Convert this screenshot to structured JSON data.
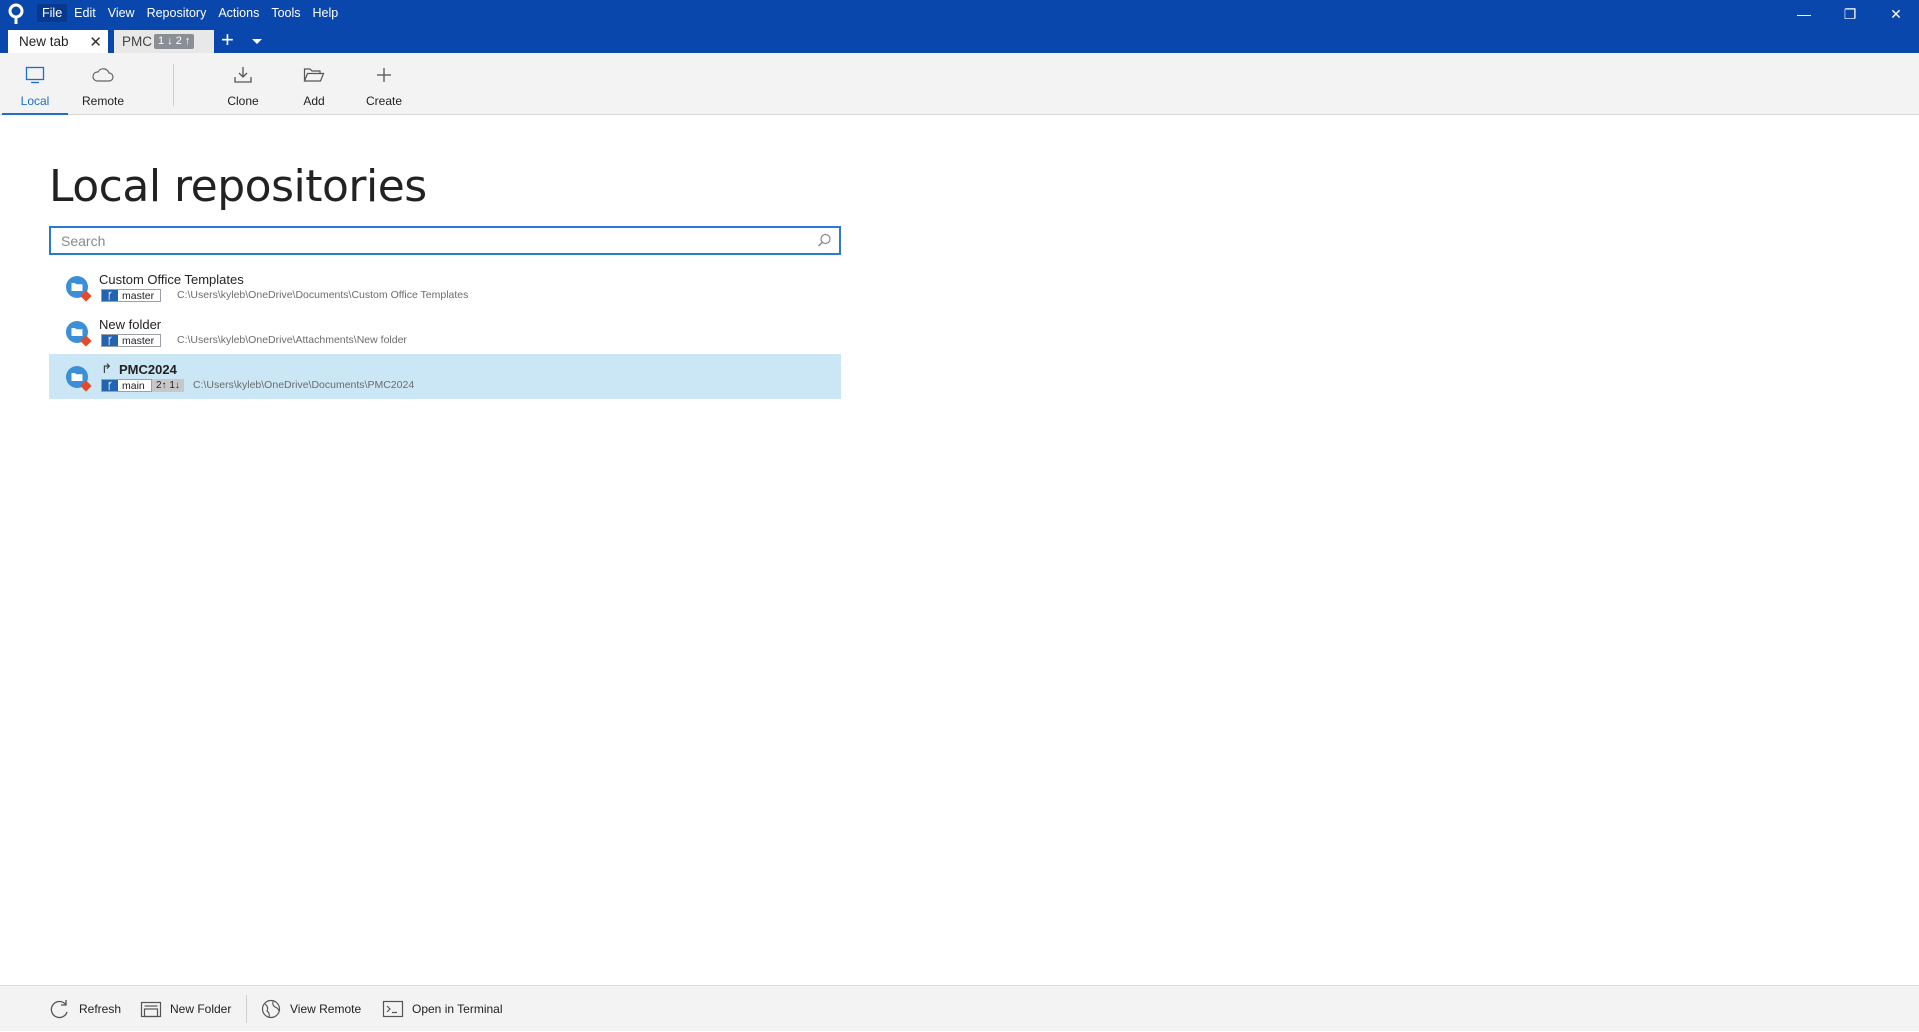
{
  "menu": {
    "items": [
      "File",
      "Edit",
      "View",
      "Repository",
      "Actions",
      "Tools",
      "Help"
    ]
  },
  "window_controls": {
    "minimize": "—",
    "restore": "❐",
    "close": "✕"
  },
  "tabs": {
    "active": {
      "label": "New tab",
      "close": "✕"
    },
    "inactive": {
      "label": "PMC",
      "badge": "1 ↓ 2 ↑"
    },
    "add": "+"
  },
  "ribbon": {
    "local": "Local",
    "remote": "Remote",
    "clone": "Clone",
    "add": "Add",
    "create": "Create"
  },
  "main": {
    "title": "Local repositories",
    "search_placeholder": "Search",
    "repos": [
      {
        "name": "Custom Office Templates",
        "branch": "master",
        "path": "C:\\Users\\kyleb\\OneDrive\\Documents\\Custom Office Templates"
      },
      {
        "name": "New folder",
        "branch": "master",
        "path": "C:\\Users\\kyleb\\OneDrive\\Attachments\\New folder"
      },
      {
        "name": "PMC2024",
        "branch": "main",
        "sync": "2↑ 1↓",
        "path": "C:\\Users\\kyleb\\OneDrive\\Documents\\PMC2024",
        "fork_icon": "↱"
      }
    ]
  },
  "bottom": {
    "refresh": "Refresh",
    "new_folder": "New Folder",
    "view_remote": "View Remote",
    "open_terminal": "Open in Terminal"
  },
  "colors": {
    "titlebar": "#0a47ad",
    "accent": "#1a6fd0",
    "selected_row": "#cbe6f4"
  }
}
